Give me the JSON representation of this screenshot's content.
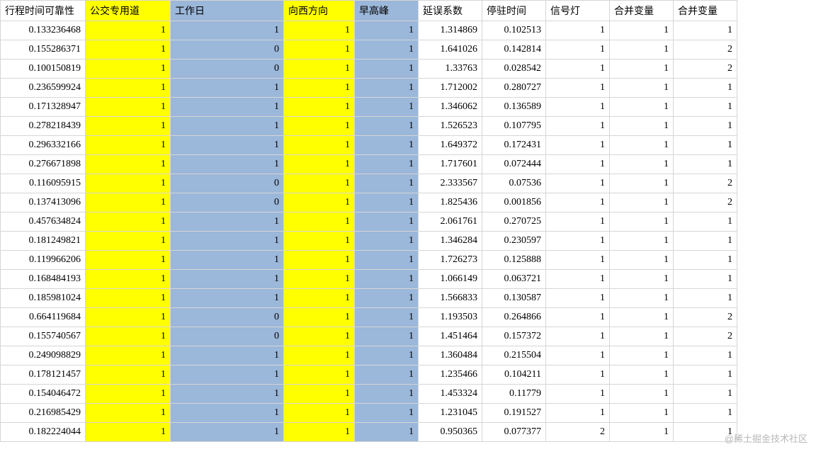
{
  "columns": [
    {
      "label": "行程时间可靠性",
      "width": 120,
      "cls": ""
    },
    {
      "label": "公交专用道",
      "width": 120,
      "cls": "col-yellow"
    },
    {
      "label": "工作日",
      "width": 160,
      "cls": "col-blue"
    },
    {
      "label": "向西方向",
      "width": 100,
      "cls": "col-yellow"
    },
    {
      "label": "早高峰",
      "width": 90,
      "cls": "col-blue"
    },
    {
      "label": "延误系数",
      "width": 90,
      "cls": ""
    },
    {
      "label": "停驻时间",
      "width": 90,
      "cls": ""
    },
    {
      "label": "信号灯",
      "width": 90,
      "cls": ""
    },
    {
      "label": "合并变量",
      "width": 90,
      "cls": ""
    },
    {
      "label": "合并变量",
      "width": 90,
      "cls": ""
    }
  ],
  "rows": [
    [
      "0.133236468",
      "1",
      "1",
      "1",
      "1",
      "1.314869",
      "0.102513",
      "1",
      "1",
      "1"
    ],
    [
      "0.155286371",
      "1",
      "0",
      "1",
      "1",
      "1.641026",
      "0.142814",
      "1",
      "1",
      "2"
    ],
    [
      "0.100150819",
      "1",
      "0",
      "1",
      "1",
      "1.33763",
      "0.028542",
      "1",
      "1",
      "2"
    ],
    [
      "0.236599924",
      "1",
      "1",
      "1",
      "1",
      "1.712002",
      "0.280727",
      "1",
      "1",
      "1"
    ],
    [
      "0.171328947",
      "1",
      "1",
      "1",
      "1",
      "1.346062",
      "0.136589",
      "1",
      "1",
      "1"
    ],
    [
      "0.278218439",
      "1",
      "1",
      "1",
      "1",
      "1.526523",
      "0.107795",
      "1",
      "1",
      "1"
    ],
    [
      "0.296332166",
      "1",
      "1",
      "1",
      "1",
      "1.649372",
      "0.172431",
      "1",
      "1",
      "1"
    ],
    [
      "0.276671898",
      "1",
      "1",
      "1",
      "1",
      "1.717601",
      "0.072444",
      "1",
      "1",
      "1"
    ],
    [
      "0.116095915",
      "1",
      "0",
      "1",
      "1",
      "2.333567",
      "0.07536",
      "1",
      "1",
      "2"
    ],
    [
      "0.137413096",
      "1",
      "0",
      "1",
      "1",
      "1.825436",
      "0.001856",
      "1",
      "1",
      "2"
    ],
    [
      "0.457634824",
      "1",
      "1",
      "1",
      "1",
      "2.061761",
      "0.270725",
      "1",
      "1",
      "1"
    ],
    [
      "0.181249821",
      "1",
      "1",
      "1",
      "1",
      "1.346284",
      "0.230597",
      "1",
      "1",
      "1"
    ],
    [
      "0.119966206",
      "1",
      "1",
      "1",
      "1",
      "1.726273",
      "0.125888",
      "1",
      "1",
      "1"
    ],
    [
      "0.168484193",
      "1",
      "1",
      "1",
      "1",
      "1.066149",
      "0.063721",
      "1",
      "1",
      "1"
    ],
    [
      "0.185981024",
      "1",
      "1",
      "1",
      "1",
      "1.566833",
      "0.130587",
      "1",
      "1",
      "1"
    ],
    [
      "0.664119684",
      "1",
      "0",
      "1",
      "1",
      "1.193503",
      "0.264866",
      "1",
      "1",
      "2"
    ],
    [
      "0.155740567",
      "1",
      "0",
      "1",
      "1",
      "1.451464",
      "0.157372",
      "1",
      "1",
      "2"
    ],
    [
      "0.249098829",
      "1",
      "1",
      "1",
      "1",
      "1.360484",
      "0.215504",
      "1",
      "1",
      "1"
    ],
    [
      "0.178121457",
      "1",
      "1",
      "1",
      "1",
      "1.235466",
      "0.104211",
      "1",
      "1",
      "1"
    ],
    [
      "0.154046472",
      "1",
      "1",
      "1",
      "1",
      "1.453324",
      "0.11779",
      "1",
      "1",
      "1"
    ],
    [
      "0.216985429",
      "1",
      "1",
      "1",
      "1",
      "1.231045",
      "0.191527",
      "1",
      "1",
      "1"
    ],
    [
      "0.182224044",
      "1",
      "1",
      "1",
      "1",
      "0.950365",
      "0.077377",
      "2",
      "1",
      "1"
    ]
  ],
  "watermark": "@稀土掘金技术社区"
}
